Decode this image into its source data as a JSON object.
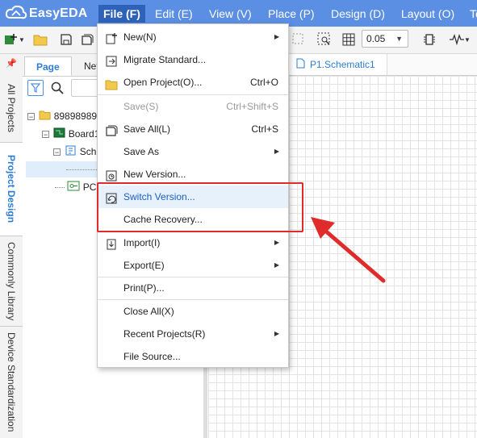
{
  "brand": {
    "name": "EasyEDA"
  },
  "menubar": {
    "items": [
      {
        "label": "File (F)",
        "active": true
      },
      {
        "label": "Edit (E)"
      },
      {
        "label": "View (V)"
      },
      {
        "label": "Place (P)"
      },
      {
        "label": "Design (D)"
      },
      {
        "label": "Layout (O)"
      },
      {
        "label": "To"
      }
    ]
  },
  "toolbar": {
    "zoom_value": "0.05"
  },
  "left_tabs": [
    "All Projects",
    "Project Design",
    "Commonly Library",
    "Device Standardization"
  ],
  "panel": {
    "tabs": [
      "Page",
      "Net"
    ],
    "tree": [
      {
        "label": "89898989",
        "icon": "folder-icon"
      },
      {
        "label": "Board1",
        "icon": "board-icon"
      },
      {
        "label": "Sch",
        "icon": "schematic-folder-icon"
      },
      {
        "label": "",
        "icon": "page-icon"
      },
      {
        "label": "PC",
        "icon": "pcb-icon"
      }
    ]
  },
  "document": {
    "tab_label": "P1.Schematic1"
  },
  "file_menu": {
    "items": [
      {
        "label": "New(N)",
        "icon": "new-icon",
        "submenu": true
      },
      {
        "label": "Migrate Standard...",
        "icon": "migrate-icon"
      },
      {
        "label": "Open Project(O)...",
        "icon": "folder-open-icon",
        "shortcut": "Ctrl+O"
      },
      {
        "label": "Save(S)",
        "shortcut": "Ctrl+Shift+S",
        "disabled": true
      },
      {
        "label": "Save All(L)",
        "icon": "save-all-icon",
        "shortcut": "Ctrl+S"
      },
      {
        "label": "Save As",
        "submenu": true
      },
      {
        "label": "New Version...",
        "icon": "new-version-icon"
      },
      {
        "label": "Switch Version...",
        "icon": "switch-version-icon",
        "highlighted": true
      },
      {
        "label": "Cache Recovery..."
      },
      {
        "label": "Import(I)",
        "icon": "import-icon",
        "submenu": true
      },
      {
        "label": "Export(E)",
        "submenu": true
      },
      {
        "label": "Print(P)..."
      },
      {
        "label": "Close All(X)"
      },
      {
        "label": "Recent Projects(R)",
        "submenu": true
      },
      {
        "label": "File Source..."
      }
    ]
  },
  "colors": {
    "menubar": "#5b8fe3",
    "accent": "#2d7dd2",
    "annotation": "#e02b2b"
  }
}
